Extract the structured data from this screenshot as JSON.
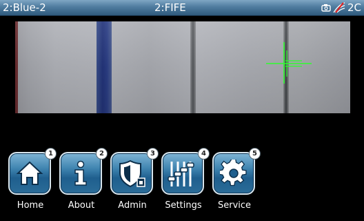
{
  "status_bar": {
    "left_label": "2:Blue-2",
    "center_label": "2:FIFE",
    "right_label": "2C",
    "icons": [
      "camera-icon",
      "signal-off-icon"
    ]
  },
  "dock": {
    "buttons": [
      {
        "label": "Home",
        "badge": "1",
        "icon": "home-icon"
      },
      {
        "label": "About",
        "badge": "2",
        "icon": "info-icon"
      },
      {
        "label": "Admin",
        "badge": "3",
        "icon": "shield-lock-icon"
      },
      {
        "label": "Settings",
        "badge": "4",
        "icon": "sliders-icon"
      },
      {
        "label": "Service",
        "badge": "5",
        "icon": "gear-icon"
      }
    ]
  },
  "colors": {
    "status_bar": "#4f7c9f",
    "tile": "#3f84b0",
    "crosshair": "#33ff33"
  }
}
